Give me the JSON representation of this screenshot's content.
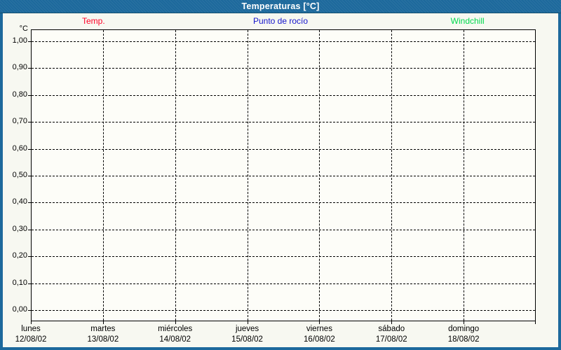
{
  "window": {
    "title": "Temperaturas [°C]"
  },
  "legend": {
    "items": [
      {
        "label": "Temp.",
        "color": "#ff0026"
      },
      {
        "label": "Punto de rocío",
        "color": "#1414cc"
      },
      {
        "label": "Windchill",
        "color": "#00d94d"
      }
    ]
  },
  "chart_data": {
    "type": "line",
    "title": "Temperaturas [°C]",
    "ylabel": "°C",
    "ylim": [
      0.0,
      1.0
    ],
    "y_tick_labels": [
      "1,00",
      "0,90",
      "0,80",
      "0,70",
      "0,60",
      "0,50",
      "0,40",
      "0,30",
      "0,20",
      "0,10",
      "0,00"
    ],
    "x_categories": [
      {
        "day": "lunes",
        "date": "12/08/02"
      },
      {
        "day": "martes",
        "date": "13/08/02"
      },
      {
        "day": "miércoles",
        "date": "14/08/02"
      },
      {
        "day": "jueves",
        "date": "15/08/02"
      },
      {
        "day": "viernes",
        "date": "16/08/02"
      },
      {
        "day": "sábado",
        "date": "17/08/02"
      },
      {
        "day": "domingo",
        "date": "18/08/02"
      }
    ],
    "series": [
      {
        "name": "Temp.",
        "color": "#ff0026",
        "values": []
      },
      {
        "name": "Punto de rocío",
        "color": "#1414cc",
        "values": []
      },
      {
        "name": "Windchill",
        "color": "#00d94d",
        "values": []
      }
    ],
    "grid": "dashed",
    "legend_position": "top"
  }
}
